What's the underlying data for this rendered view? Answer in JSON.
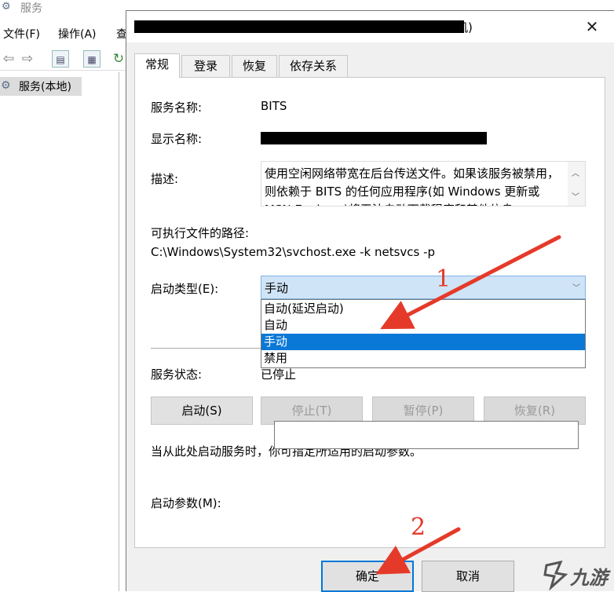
{
  "background_window": {
    "title": "服务",
    "menu": [
      "文件(F)",
      "操作(A)",
      "查"
    ],
    "tree_item": "服务(本地)"
  },
  "dialog": {
    "title_visible_tail": "机)",
    "tabs": [
      "常规",
      "登录",
      "恢复",
      "依存关系"
    ],
    "fields": {
      "service_name_label": "服务名称:",
      "service_name_value": "BITS",
      "display_name_label": "显示名称:",
      "description_label": "描述:",
      "description_text": "使用空闲网络带宽在后台传送文件。如果该服务被禁用，则依赖于 BITS 的任何应用程序(如 Windows 更新或 MSN Explorer)将无法自动下载程序和其他信息。",
      "exe_path_label": "可执行文件的路径:",
      "exe_path_value": "C:\\Windows\\System32\\svchost.exe -k netsvcs -p",
      "startup_type_label": "启动类型(E):",
      "startup_type_value": "手动",
      "startup_options": [
        "自动(延迟启动)",
        "自动",
        "手动",
        "禁用"
      ],
      "startup_selected_index": 2,
      "service_status_label": "服务状态:",
      "service_status_value": "已停止"
    },
    "buttons": {
      "start": "启动(S)",
      "stop": "停止(T)",
      "pause": "暂停(P)",
      "resume": "恢复(R)"
    },
    "hint": "当从此处启动服务时，你可指定所适用的启动参数。",
    "params_label": "启动参数(M):",
    "params_value": "",
    "ok": "确定",
    "cancel": "取消"
  },
  "annotations": {
    "num1": "1",
    "num2": "2",
    "color": "#e53a2a"
  },
  "watermark": {
    "text": "九游"
  },
  "icons": [
    "services-icon",
    "back-arrow-icon",
    "forward-arrow-icon",
    "console-tree-icon",
    "properties-icon",
    "refresh-icon",
    "close-icon",
    "chevron-up-icon",
    "chevron-down-icon"
  ]
}
